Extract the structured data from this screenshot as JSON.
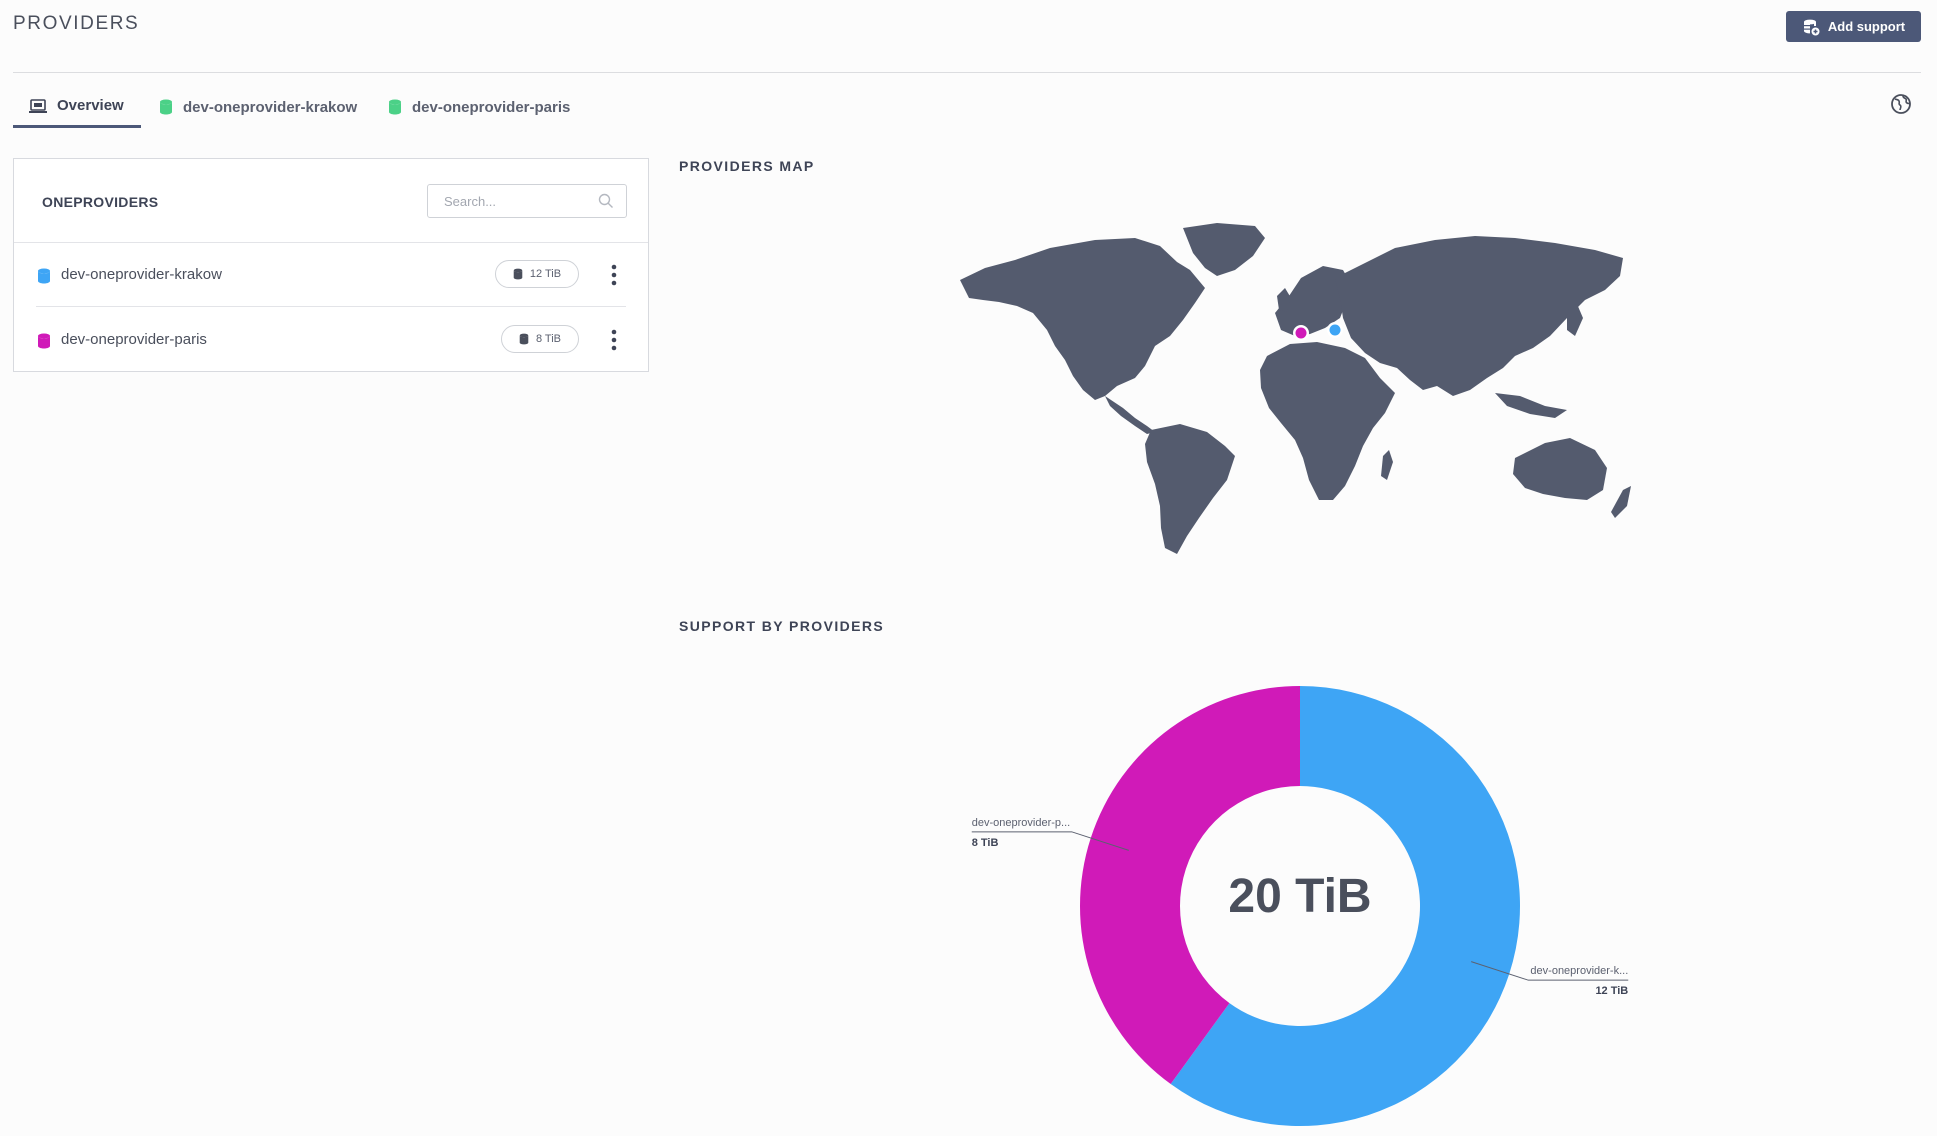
{
  "header": {
    "title": "PROVIDERS",
    "add_support_label": "Add support"
  },
  "tabs": [
    {
      "label": "Overview",
      "icon": "overview-icon",
      "active": true
    },
    {
      "label": "dev-oneprovider-krakow",
      "icon": "database-icon",
      "color": "#4bd187"
    },
    {
      "label": "dev-oneprovider-paris",
      "icon": "database-icon",
      "color": "#4bd187"
    }
  ],
  "oneproviders": {
    "title": "ONEPROVIDERS",
    "search_placeholder": "Search...",
    "items": [
      {
        "name": "dev-oneprovider-krakow",
        "size": "12 TiB",
        "color": "#3ea5f5"
      },
      {
        "name": "dev-oneprovider-paris",
        "size": "8 TiB",
        "color": "#d01ab8"
      }
    ]
  },
  "map": {
    "title": "PROVIDERS MAP",
    "markers": [
      {
        "provider": "dev-oneprovider-paris",
        "color": "#d01ab8"
      },
      {
        "provider": "dev-oneprovider-krakow",
        "color": "#3ea5f5"
      }
    ]
  },
  "support": {
    "title": "SUPPORT BY PROVIDERS",
    "total_label": "20 TiB"
  },
  "chart_data": {
    "type": "pie",
    "title": "SUPPORT BY PROVIDERS",
    "center_label": "20 TiB",
    "unit": "TiB",
    "slices": [
      {
        "label": "dev-oneprovider-krakow",
        "short_label": "dev-oneprovider-k...",
        "value": 12,
        "value_label": "12 TiB",
        "color": "#3ea5f5"
      },
      {
        "label": "dev-oneprovider-paris",
        "short_label": "dev-oneprovider-p...",
        "value": 8,
        "value_label": "8 TiB",
        "color": "#d01ab8"
      }
    ]
  }
}
